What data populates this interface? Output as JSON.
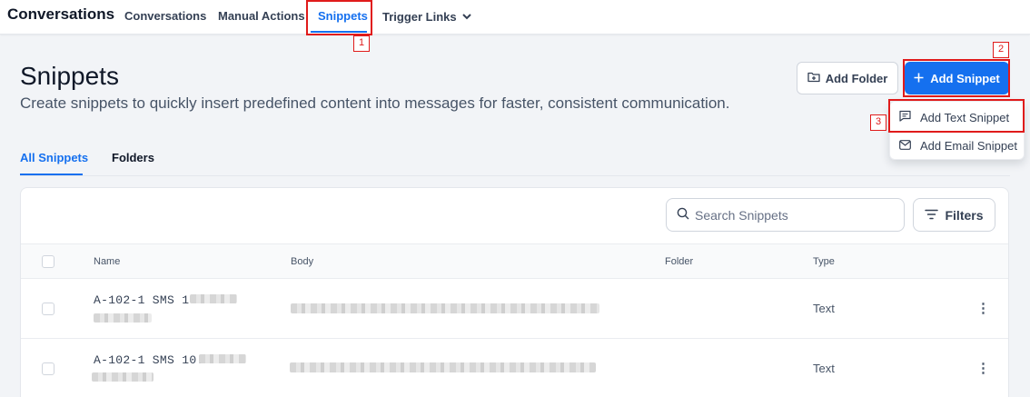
{
  "app": {
    "title": "Conversations"
  },
  "nav": {
    "tabs": [
      {
        "label": "Conversations"
      },
      {
        "label": "Manual Actions"
      },
      {
        "label": "Snippets"
      },
      {
        "label": "Trigger Links"
      }
    ]
  },
  "annotations": [
    "1",
    "2",
    "3"
  ],
  "header": {
    "title": "Snippets",
    "subtitle": "Create snippets to quickly insert predefined content into messages for faster, consistent communication.",
    "add_folder": "Add Folder",
    "add_snippet": "Add Snippet"
  },
  "dropdown": {
    "items": [
      {
        "label": "Add Text Snippet",
        "icon": "message-text-icon"
      },
      {
        "label": "Add Email Snippet",
        "icon": "mail-icon"
      }
    ]
  },
  "tabs": [
    {
      "label": "All Snippets"
    },
    {
      "label": "Folders"
    }
  ],
  "toolbar": {
    "search_placeholder": "Search Snippets",
    "filters": "Filters"
  },
  "table": {
    "columns": [
      "Name",
      "Body",
      "Folder",
      "Type"
    ],
    "rows": [
      {
        "name": "A-102-1 SMS 1:",
        "type": "Text"
      },
      {
        "name": "A-102-1 SMS 10:",
        "type": "Text"
      }
    ]
  },
  "colors": {
    "accent": "#1570ef",
    "annotation": "#e01b1b"
  }
}
